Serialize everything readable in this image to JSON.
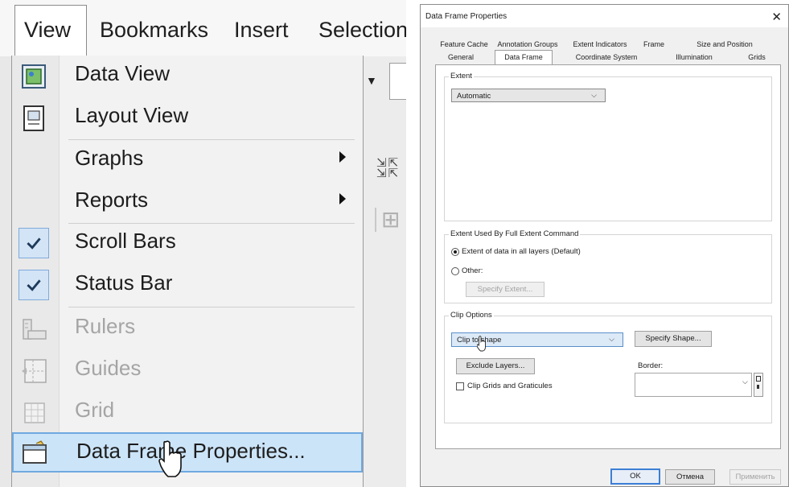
{
  "menubar": {
    "items": [
      "View",
      "Bookmarks",
      "Insert",
      "Selection"
    ]
  },
  "view_menu": {
    "items": [
      {
        "label": "Data View",
        "icon": "data-view-icon"
      },
      {
        "label": "Layout View",
        "icon": "layout-view-icon"
      },
      {
        "label": "Graphs",
        "submenu": true
      },
      {
        "label": "Reports",
        "submenu": true
      },
      {
        "label": "Scroll Bars",
        "checked": true
      },
      {
        "label": "Status Bar",
        "checked": true
      },
      {
        "label": "Rulers",
        "disabled": true,
        "icon": "rulers-icon"
      },
      {
        "label": "Guides",
        "disabled": true,
        "icon": "guides-icon"
      },
      {
        "label": "Grid",
        "disabled": true,
        "icon": "grid-icon"
      },
      {
        "label": "Data Frame Properties...",
        "highlighted": true,
        "icon": "data-frame-properties-icon"
      }
    ]
  },
  "dialog": {
    "title": "Data Frame Properties",
    "close_glyph": "✕",
    "tabs_back": [
      "Feature Cache",
      "Annotation Groups",
      "Extent Indicators",
      "Frame",
      "Size and Position"
    ],
    "tabs_front": [
      "General",
      "Data Frame",
      "Coordinate System",
      "Illumination",
      "Grids"
    ],
    "active_tab": "Data Frame",
    "extent": {
      "group_label": "Extent",
      "value": "Automatic"
    },
    "full_extent": {
      "group_label": "Extent Used By Full Extent Command",
      "option_default": "Extent of data in all layers (Default)",
      "option_other": "Other:",
      "specify_button": "Specify Extent..."
    },
    "clip": {
      "group_label": "Clip Options",
      "value": "Clip to shape",
      "specify_shape": "Specify Shape...",
      "exclude_layers": "Exclude Layers...",
      "border_label": "Border:",
      "clip_grids_label": "Clip Grids and Graticules"
    },
    "buttons": {
      "ok": "OK",
      "cancel": "Отмена",
      "apply": "Применить"
    }
  }
}
